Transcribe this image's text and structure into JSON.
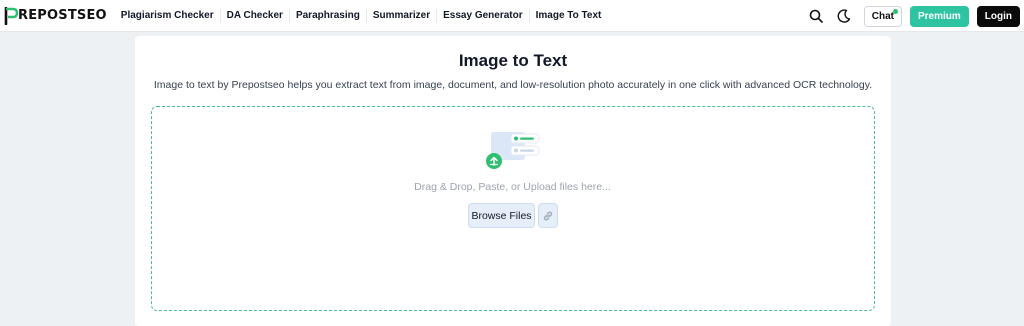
{
  "header": {
    "logo_text": "REPOSTSEO",
    "logo_letter": "P",
    "nav": [
      {
        "label": "Plagiarism Checker"
      },
      {
        "label": "DA Checker"
      },
      {
        "label": "Paraphrasing"
      },
      {
        "label": "Summarizer"
      },
      {
        "label": "Essay Generator"
      },
      {
        "label": "Image To Text"
      }
    ],
    "chat_label": "Chat",
    "premium_label": "Premium",
    "login_label": "Login"
  },
  "main": {
    "title": "Image to Text",
    "subtitle": "Image to text by Prepostseo helps you extract text from image, document, and low-resolution photo accurately in one click with advanced OCR technology.",
    "drop_text": "Drag & Drop, Paste, or Upload files here...",
    "browse_label": "Browse Files"
  },
  "colors": {
    "accent": "#2ec4a2",
    "dropzone_border": "#4bbd8a",
    "login_bg": "#0b0b0b",
    "page_bg": "#eef1f4"
  },
  "icons": [
    "search-icon",
    "moon-icon",
    "upload-icon",
    "link-icon"
  ]
}
